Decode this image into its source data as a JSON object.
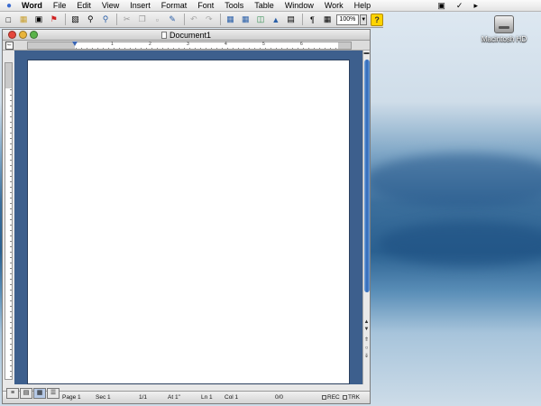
{
  "menubar": {
    "app_name": "Word",
    "items": [
      "File",
      "Edit",
      "View",
      "Insert",
      "Format",
      "Font",
      "Tools",
      "Table",
      "Window",
      "Work",
      "Help"
    ],
    "status_icons": [
      "display-icon",
      "volume-icon",
      "speaker-icon"
    ]
  },
  "toolbar": {
    "buttons": [
      "new-icon",
      "open-icon",
      "save-icon",
      "flag-icon",
      "print-icon",
      "print-preview-icon",
      "find-icon",
      "cut-icon",
      "copy-icon",
      "paste-icon",
      "format-painter-icon",
      "undo-icon",
      "redo-icon",
      "tables-borders-icon",
      "insert-table-icon",
      "columns-icon",
      "drawing-icon",
      "document-map-icon",
      "show-hide-icon",
      "text-box-icon",
      "help-icon"
    ],
    "zoom_value": "100%"
  },
  "document": {
    "title": "Document1"
  },
  "ruler": {
    "labels": [
      "1",
      "2",
      "3",
      "4",
      "5",
      "6"
    ]
  },
  "statusbar": {
    "page": "Page 1",
    "sec": "Sec 1",
    "pages": "1/1",
    "at": "At 1\"",
    "ln": "Ln 1",
    "col": "Col 1",
    "words": "0/0",
    "rec": "REC",
    "trk": "TRK"
  },
  "desktop": {
    "hd_label": "Macintosh HD"
  },
  "colors": {
    "accent": "#3864b4",
    "desktop_blue": "#2b6191",
    "canvas_bg": "#3d5f8d"
  }
}
